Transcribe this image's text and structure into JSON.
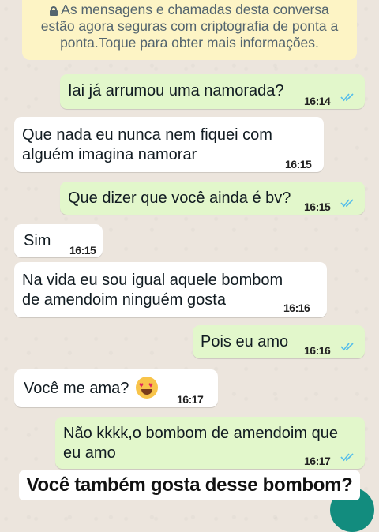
{
  "encryption_notice": {
    "line1": "As mensagens e chamadas desta conversa",
    "line2": "estão agora seguras com criptografia de ponta a",
    "line3": "ponta.Toque para obter mais informações."
  },
  "messages": [
    {
      "direction": "outgoing",
      "lines": [
        "Iai já arrumou uma namorada?"
      ],
      "time": "16:14",
      "status": "read"
    },
    {
      "direction": "incoming",
      "lines": [
        "Que nada eu nunca nem fiquei com",
        "alguém imagina namorar"
      ],
      "time": "16:15"
    },
    {
      "direction": "outgoing",
      "lines": [
        "Que dizer que você ainda é bv?"
      ],
      "time": "16:15",
      "status": "read"
    },
    {
      "direction": "incoming",
      "lines": [
        "Sim"
      ],
      "time": "16:15"
    },
    {
      "direction": "incoming",
      "lines": [
        "Na vida eu sou igual aquele bombom",
        "de amendoim ninguém gosta"
      ],
      "time": "16:16"
    },
    {
      "direction": "outgoing",
      "lines": [
        "Pois eu amo"
      ],
      "time": "16:16",
      "status": "read"
    },
    {
      "direction": "incoming",
      "lines": [
        "Você me ama?"
      ],
      "time": "16:17",
      "emoji": "heart-eyes-emoji"
    },
    {
      "direction": "outgoing",
      "lines": [
        "Não kkkk,o bombom de amendoim que",
        "eu amo"
      ],
      "time": "16:17",
      "status": "read"
    }
  ],
  "caption": "Você também gosta desse bombom?",
  "colors": {
    "background": "#ece5dd",
    "incoming_bubble": "#ffffff",
    "outgoing_bubble": "#e2f7cb",
    "notice_bg": "#fdf4c5",
    "read_ticks": "#53bdeb",
    "fab": "#128c7e"
  }
}
